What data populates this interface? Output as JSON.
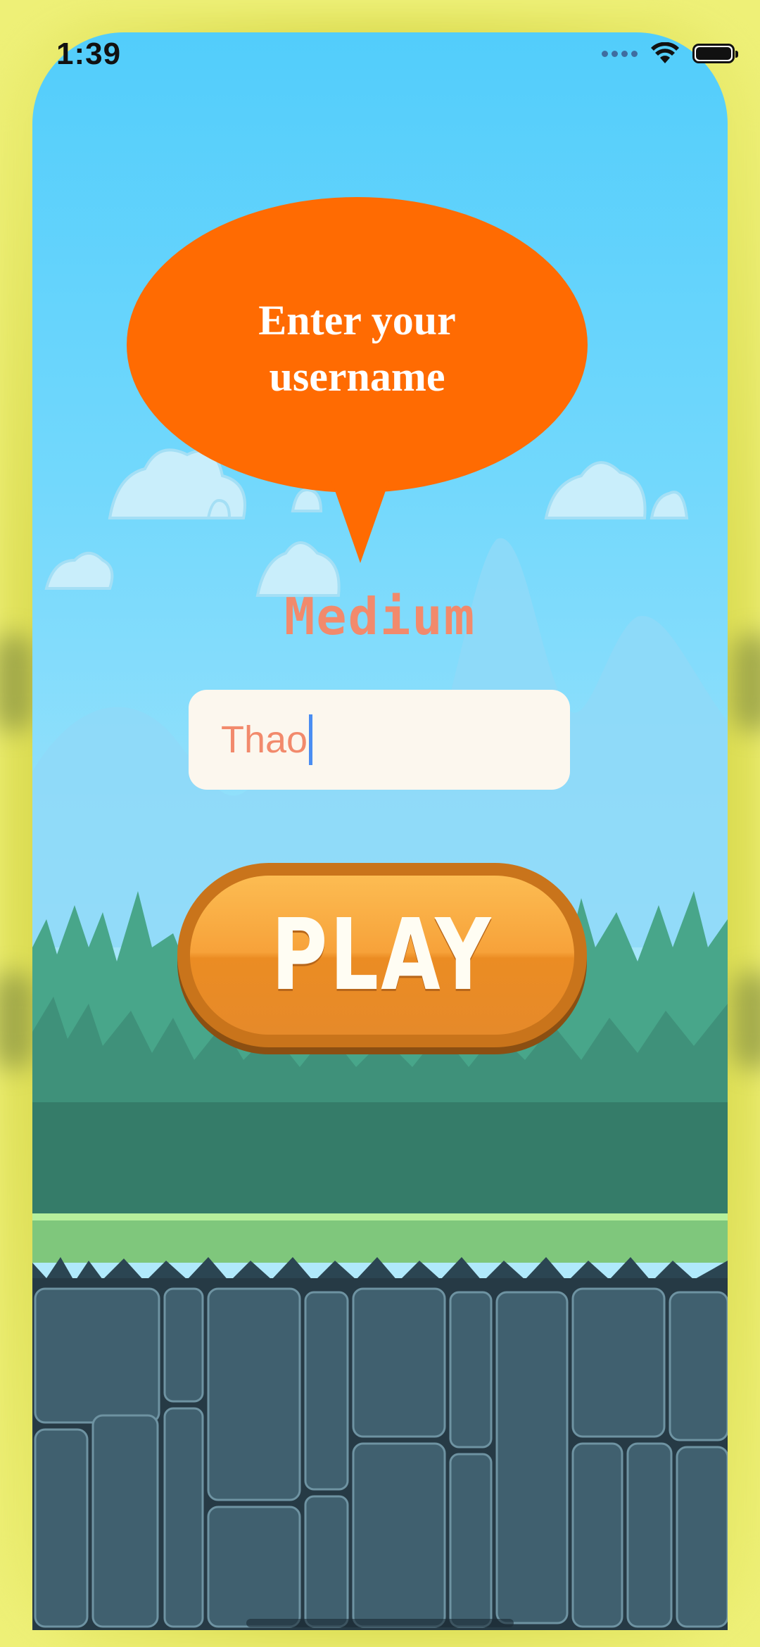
{
  "status_bar": {
    "time": "1:39",
    "icons": [
      "cellular-icon",
      "wifi-icon",
      "battery-icon"
    ]
  },
  "prompt": {
    "line1": "Enter your",
    "line2": "username"
  },
  "difficulty_label": "Medium",
  "username_field": {
    "value": "Thao"
  },
  "play_button": {
    "label": "PLAY"
  },
  "colors": {
    "bubble": "#ff6b02",
    "difficulty_text": "#f28a6c",
    "input_background": "#fcf7ee",
    "sky": "#52cdfb",
    "play_button": "#f7a23a"
  }
}
